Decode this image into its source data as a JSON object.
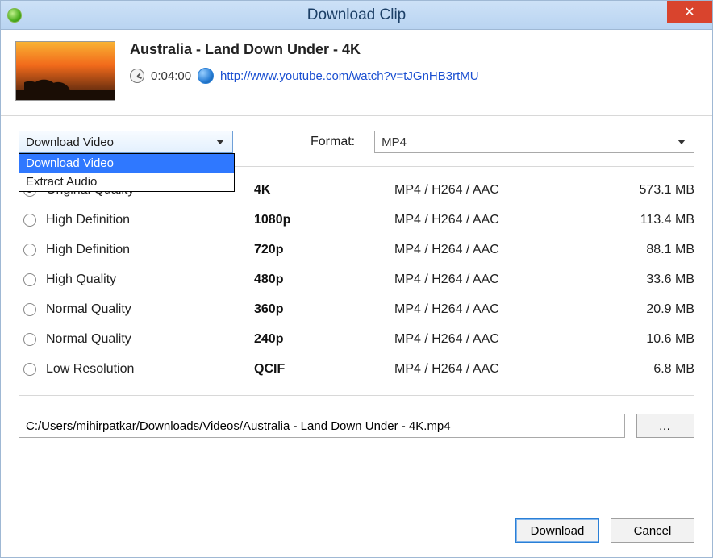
{
  "titlebar": {
    "title": "Download Clip"
  },
  "video": {
    "title": "Australia - Land Down Under - 4K",
    "duration": "0:04:00",
    "url": "http://www.youtube.com/watch?v=tJGnHB3rtMU"
  },
  "action_dropdown": {
    "selected": "Download Video",
    "options": [
      "Download Video",
      "Extract Audio"
    ]
  },
  "format": {
    "label": "Format:",
    "selected": "MP4"
  },
  "quality_options": [
    {
      "selected": true,
      "quality": "Original Quality",
      "resolution": "4K",
      "codec": "MP4 / H264 / AAC",
      "size": "573.1 MB"
    },
    {
      "selected": false,
      "quality": "High Definition",
      "resolution": "1080p",
      "codec": "MP4 / H264 / AAC",
      "size": "113.4 MB"
    },
    {
      "selected": false,
      "quality": "High Definition",
      "resolution": "720p",
      "codec": "MP4 / H264 / AAC",
      "size": "88.1 MB"
    },
    {
      "selected": false,
      "quality": "High Quality",
      "resolution": "480p",
      "codec": "MP4 / H264 / AAC",
      "size": "33.6 MB"
    },
    {
      "selected": false,
      "quality": "Normal Quality",
      "resolution": "360p",
      "codec": "MP4 / H264 / AAC",
      "size": "20.9 MB"
    },
    {
      "selected": false,
      "quality": "Normal Quality",
      "resolution": "240p",
      "codec": "MP4 / H264 / AAC",
      "size": "10.6 MB"
    },
    {
      "selected": false,
      "quality": "Low Resolution",
      "resolution": "QCIF",
      "codec": "MP4 / H264 / AAC",
      "size": "6.8 MB"
    }
  ],
  "save_path": "C:/Users/mihirpatkar/Downloads/Videos/Australia - Land Down Under - 4K.mp4",
  "buttons": {
    "browse": "…",
    "download": "Download",
    "cancel": "Cancel"
  }
}
